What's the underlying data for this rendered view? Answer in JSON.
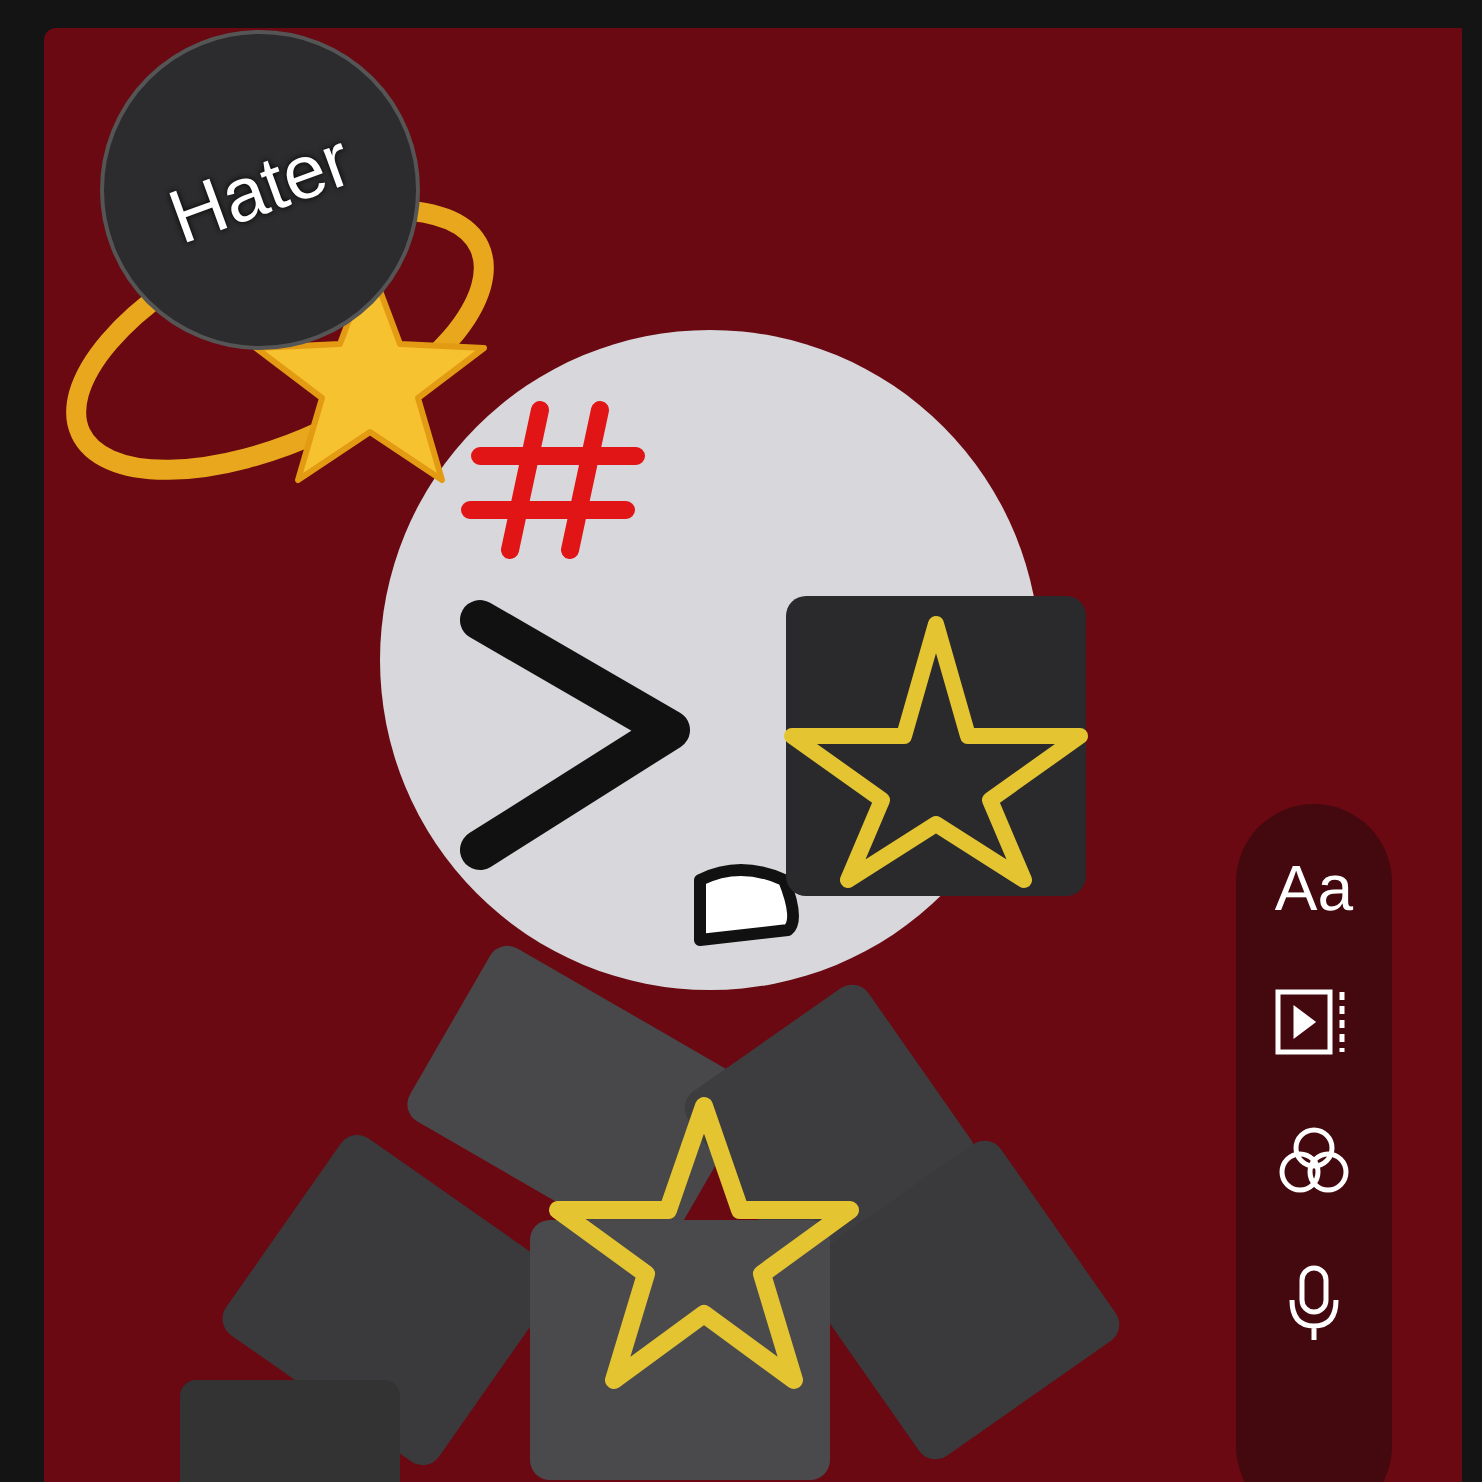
{
  "sticker": {
    "text": "Hater"
  },
  "toolbar": {
    "items": [
      {
        "kind": "text",
        "label": "Aa"
      },
      {
        "kind": "layout"
      },
      {
        "kind": "effects"
      },
      {
        "kind": "mic"
      }
    ]
  }
}
